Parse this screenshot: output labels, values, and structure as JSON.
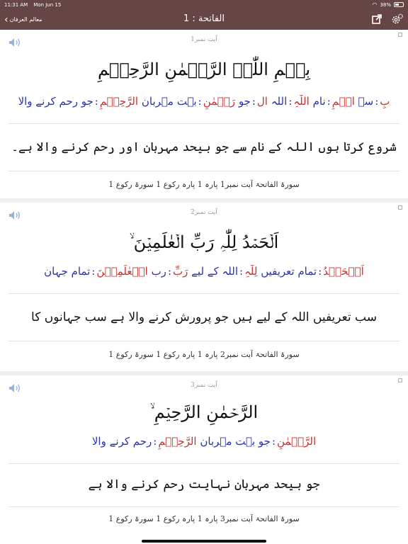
{
  "status_bar": {
    "time": "11:31 AM",
    "date": "Mon Jun 15",
    "battery": "38%"
  },
  "nav": {
    "back_label": "معالم العرفان",
    "title": "الفاتحة : 1"
  },
  "verses": [
    {
      "number_label": "آیت نمبر1",
      "arabic": "بِسۡمِ اللّٰہِ الرَّحۡمٰنِ الرَّحِیۡمِ",
      "words": [
        {
          "ar": "بِ",
          "ur": "سے"
        },
        {
          "ar": "اسۡمِ",
          "ur": "نام"
        },
        {
          "ar": "اللّٰہِ",
          "ur": "اللہ"
        },
        {
          "ar": "ال",
          "ur": "جو"
        },
        {
          "ar": "رَحۡمٰنِ",
          "ur": "بہت مہربان"
        },
        {
          "ar": "الرَّحِیۡمِ",
          "ur": "جو رحم کرنے والا"
        }
      ],
      "translation": "شروع کرتا ہوں اللہ کے نام سے جو بیحد مہربان اور رحم کرنے والا ہے۔",
      "reference": "سورۃ الفاتحۃ آیت نمبر1 پارہ 1 پارہ رکوع 1 سورۃ رکوع 1"
    },
    {
      "number_label": "آیت نمبر2",
      "arabic": "اَلۡحَمۡدُ لِلّٰہِ رَبِّ الۡعٰلَمِیۡنَ ۙ",
      "words": [
        {
          "ar": "اَلۡحَمۡدُ",
          "ur": "تمام تعریفیں"
        },
        {
          "ar": "لِلّٰہِ",
          "ur": "اللہ کے لیے"
        },
        {
          "ar": "رَبِّ",
          "ur": "رب"
        },
        {
          "ar": "الۡعٰلَمِیۡنَ",
          "ur": "تمام جہان"
        }
      ],
      "translation": "سب تعریفیں اللہ کے لیے ہیں جو پرورش کرنے والا ہے سب جہانوں کا",
      "reference": "سورۃ الفاتحۃ آیت نمبر2 پارہ 1 پارہ رکوع 1 سورۃ رکوع 1"
    },
    {
      "number_label": "آیت نمبر3",
      "arabic": "الرَّحۡمٰنِ الرَّحِیۡمِ ۙ",
      "words": [
        {
          "ar": "الرَّحۡمٰنِ",
          "ur": "جو بہت مہربان"
        },
        {
          "ar": "الرَّحِیۡمِ",
          "ur": "رحم کرنے والا"
        }
      ],
      "translation": "جو بیحد مہربان نہایت رحم کرنے والا ہے",
      "reference": "سورۃ الفاتحۃ آیت نمبر3 پارہ 1 پارہ رکوع 1 سورۃ رکوع 1"
    }
  ],
  "icons": {
    "back": "chevron-left-icon",
    "share": "share-icon",
    "settings": "gear-icon",
    "audio": "speaker-icon"
  },
  "colors": {
    "bar": "#654546",
    "arabic_word": "#c8302d",
    "urdu_word": "#2b2fb3"
  }
}
